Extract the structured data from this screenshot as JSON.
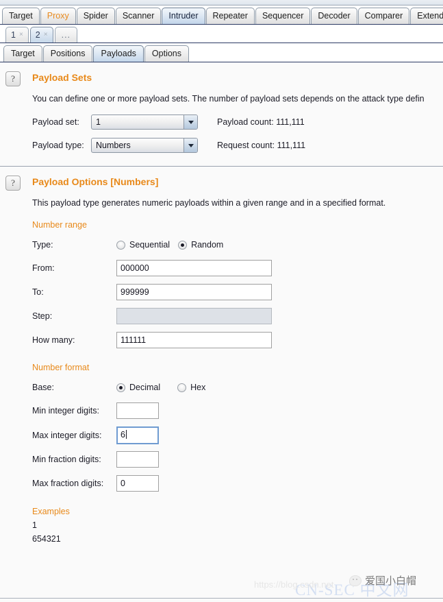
{
  "main_tabs": [
    {
      "label": "Target",
      "selected": false,
      "accent": false
    },
    {
      "label": "Proxy",
      "selected": false,
      "accent": true
    },
    {
      "label": "Spider",
      "selected": false,
      "accent": false
    },
    {
      "label": "Scanner",
      "selected": false,
      "accent": false
    },
    {
      "label": "Intruder",
      "selected": true,
      "accent": false
    },
    {
      "label": "Repeater",
      "selected": false,
      "accent": false
    },
    {
      "label": "Sequencer",
      "selected": false,
      "accent": false
    },
    {
      "label": "Decoder",
      "selected": false,
      "accent": false
    },
    {
      "label": "Comparer",
      "selected": false,
      "accent": false
    },
    {
      "label": "Extender",
      "selected": false,
      "accent": false
    }
  ],
  "attack_tabs": [
    {
      "label": "1",
      "close": "×",
      "selected": false
    },
    {
      "label": "2",
      "close": "×",
      "selected": true
    },
    {
      "label": "...",
      "close": "",
      "selected": false
    }
  ],
  "sub_tabs": [
    {
      "label": "Target",
      "selected": false
    },
    {
      "label": "Positions",
      "selected": false
    },
    {
      "label": "Payloads",
      "selected": true
    },
    {
      "label": "Options",
      "selected": false
    }
  ],
  "payload_sets": {
    "help_icon": "?",
    "title": "Payload Sets",
    "description": "You can define one or more payload sets. The number of payload sets depends on the attack type defin",
    "payload_set_label": "Payload set:",
    "payload_set_value": "1",
    "payload_type_label": "Payload type:",
    "payload_type_value": "Numbers",
    "payload_count_label": "Payload count:",
    "payload_count_value": "111,111",
    "request_count_label": "Request count:",
    "request_count_value": "111,111"
  },
  "payload_options": {
    "help_icon": "?",
    "title": "Payload Options [Numbers]",
    "description": "This payload type generates numeric payloads within a given range and in a specified format.",
    "number_range": {
      "heading": "Number range",
      "type_label": "Type:",
      "type_options": [
        {
          "label": "Sequential",
          "selected": false
        },
        {
          "label": "Random",
          "selected": true
        }
      ],
      "from_label": "From:",
      "from_value": "000000",
      "to_label": "To:",
      "to_value": "999999",
      "step_label": "Step:",
      "step_value": "",
      "step_disabled": true,
      "how_many_label": "How many:",
      "how_many_value": "111111"
    },
    "number_format": {
      "heading": "Number format",
      "base_label": "Base:",
      "base_options": [
        {
          "label": "Decimal",
          "selected": true
        },
        {
          "label": "Hex",
          "selected": false
        }
      ],
      "min_int_label": "Min integer digits:",
      "min_int_value": "",
      "max_int_label": "Max integer digits:",
      "max_int_value": "6",
      "max_int_focused": true,
      "min_frac_label": "Min fraction digits:",
      "min_frac_value": "",
      "max_frac_label": "Max fraction digits:",
      "max_frac_value": "0"
    },
    "examples": {
      "heading": "Examples",
      "values": [
        "1",
        "654321"
      ]
    }
  },
  "watermarks": {
    "url": "https://blog.csdn.net",
    "cnsec": "CN-SEC 中文网",
    "wechat": "爱国小白帽"
  },
  "colors": {
    "accent_orange": "#e8891a",
    "selected_tab": "#c3d6ea",
    "panel_bg": "#fafafa"
  }
}
